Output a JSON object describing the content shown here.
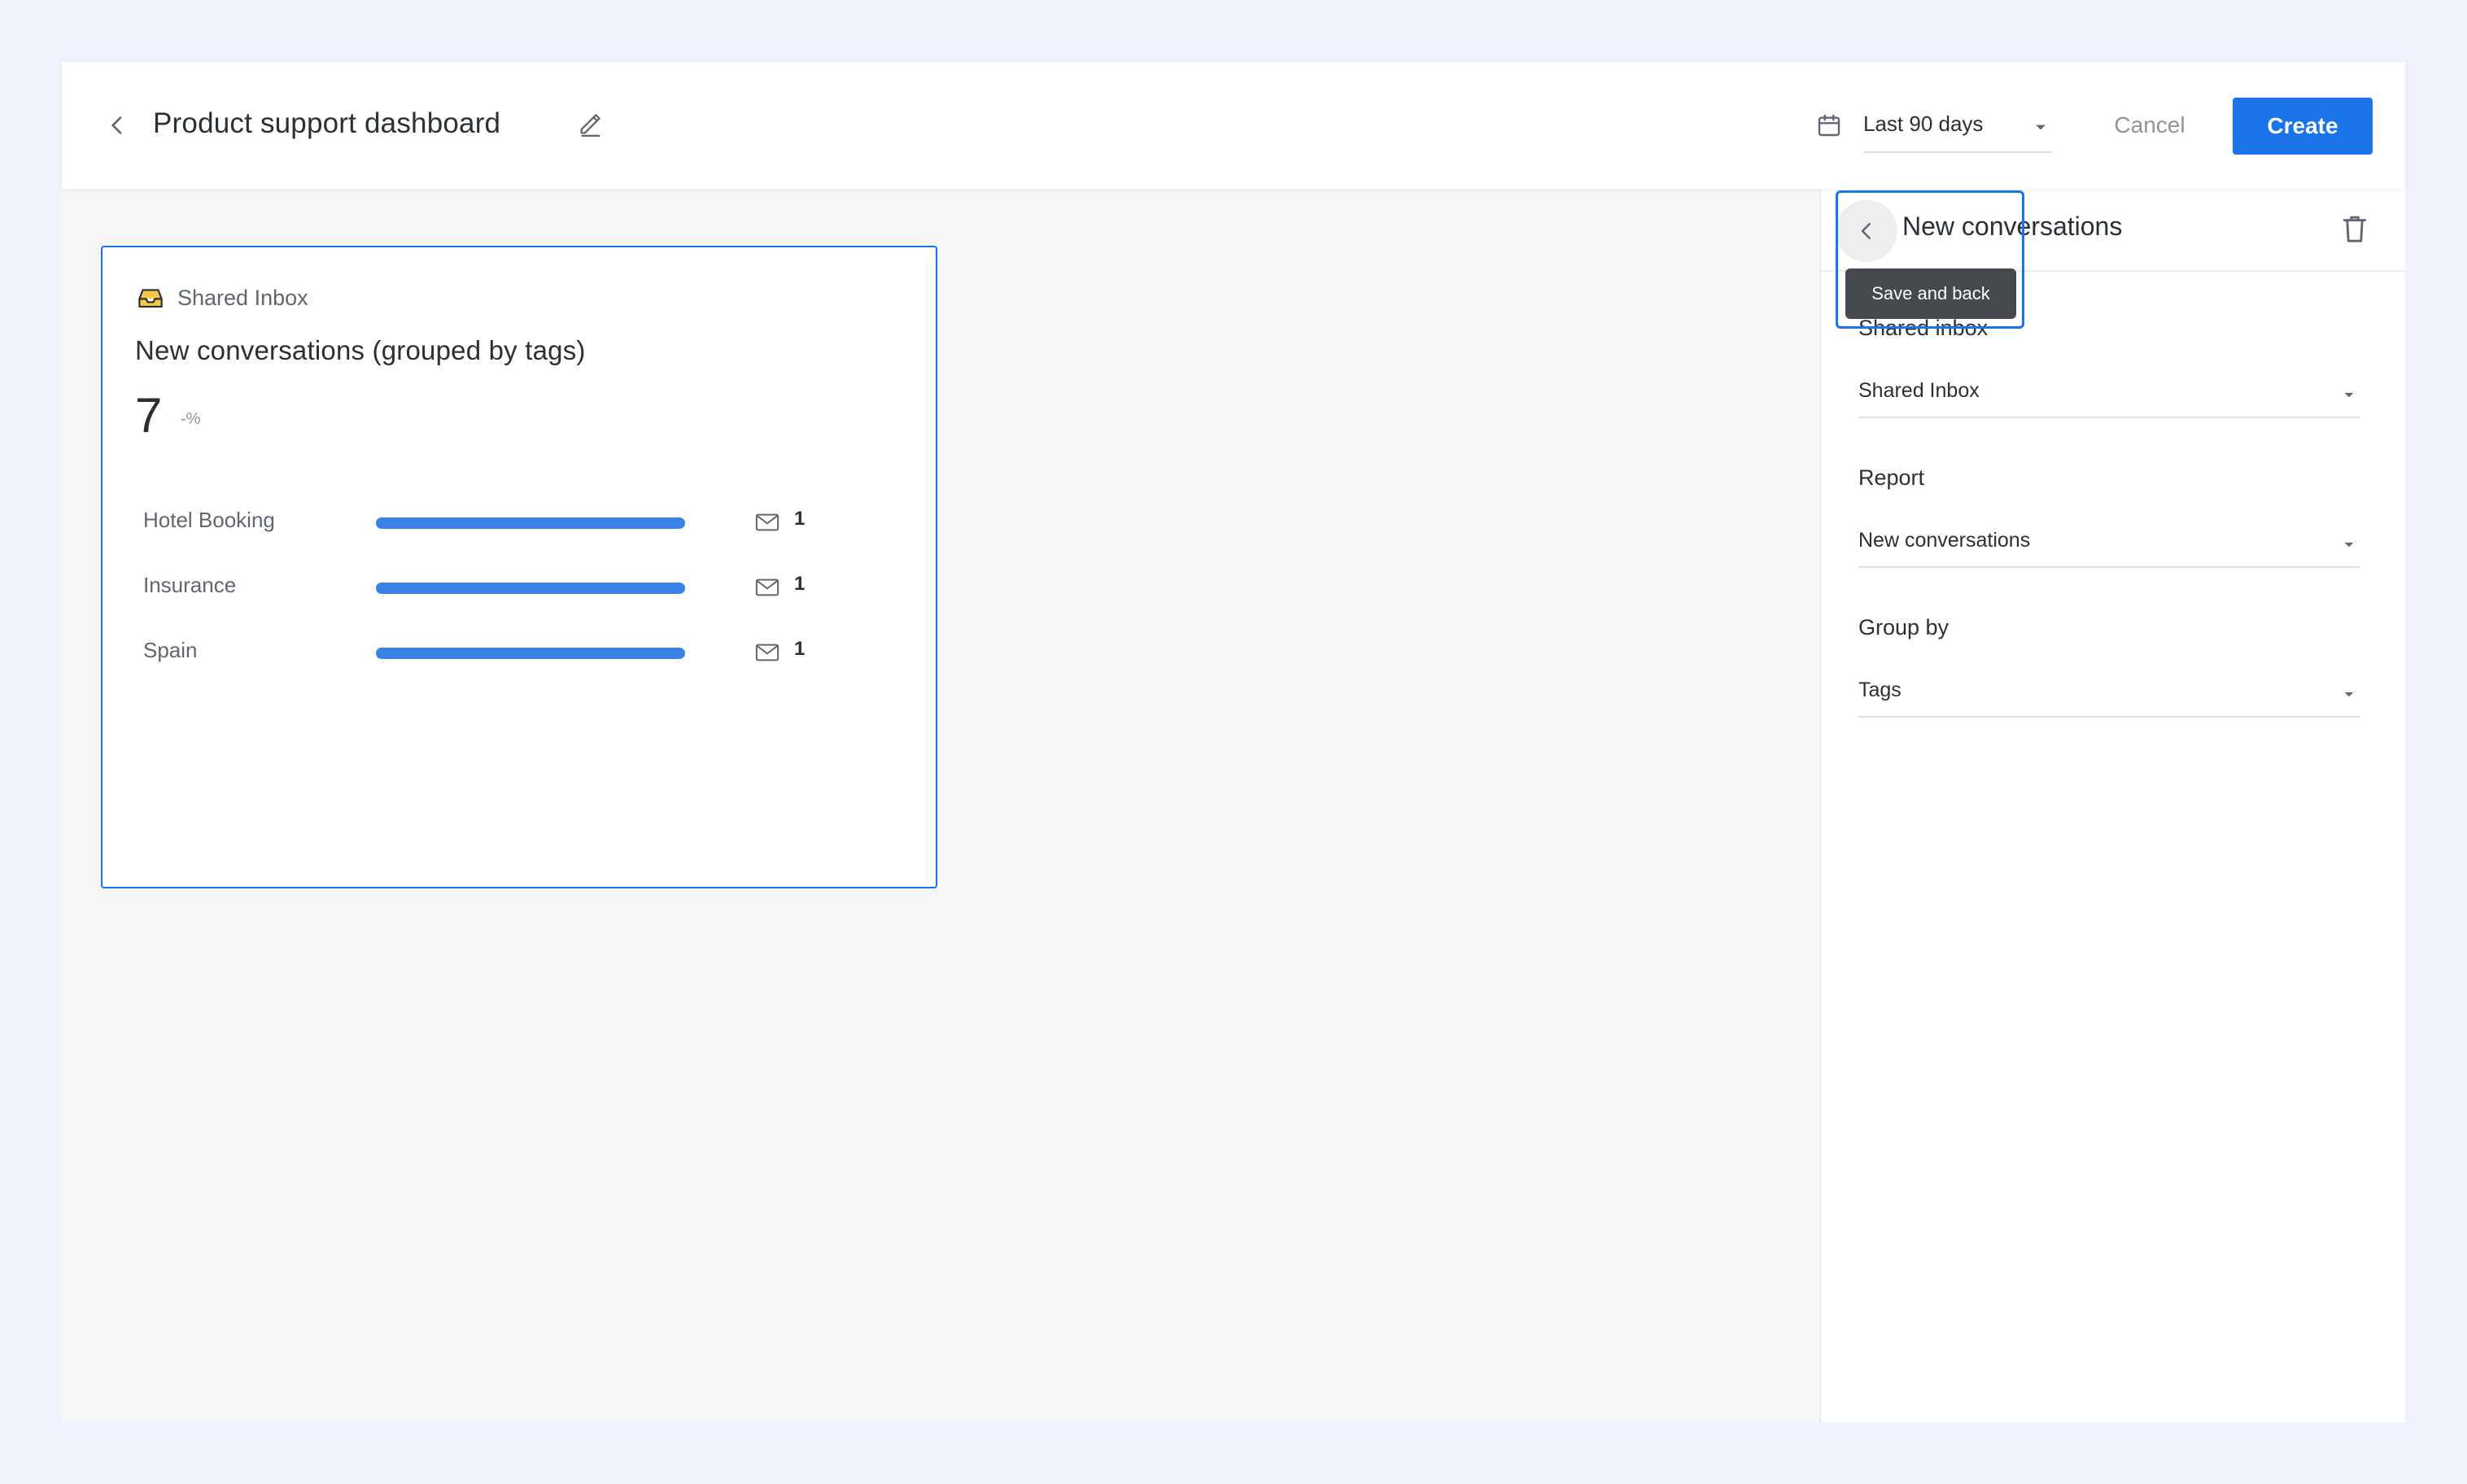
{
  "header": {
    "title": "Product support dashboard",
    "date_range": "Last 90 days",
    "cancel_label": "Cancel",
    "create_label": "Create"
  },
  "widget": {
    "source_label": "Shared Inbox",
    "title": "New conversations (grouped by tags)",
    "value": "7",
    "delta": "-%",
    "rows": [
      {
        "label": "Hotel Booking",
        "count": "1",
        "fraction": 1.0
      },
      {
        "label": "Insurance",
        "count": "1",
        "fraction": 1.0
      },
      {
        "label": "Spain",
        "count": "1",
        "fraction": 1.0
      }
    ]
  },
  "panel": {
    "title": "New conversations",
    "tooltip": "Save and back",
    "fields": [
      {
        "label": "Shared inbox",
        "value": "Shared Inbox"
      },
      {
        "label": "Report",
        "value": "New conversations"
      },
      {
        "label": "Group by",
        "value": "Tags"
      }
    ]
  },
  "colors": {
    "accent": "#1a73e8",
    "bar": "#3b82e4",
    "inbox_icon": "#f2c94c"
  },
  "icons": [
    "chevron-left-icon",
    "pencil-icon",
    "calendar-icon",
    "caret-down-icon",
    "inbox-icon",
    "mail-icon",
    "trash-icon"
  ]
}
